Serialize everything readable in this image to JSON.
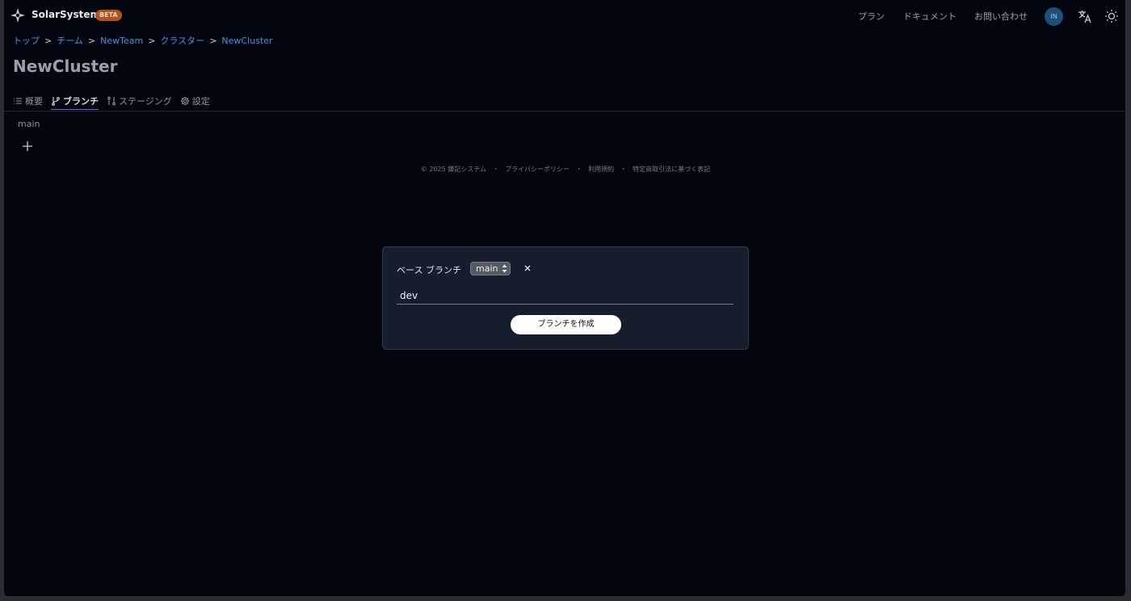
{
  "header": {
    "brand": "SolarSystem",
    "badge": "BETA",
    "nav": [
      "プラン",
      "ドキュメント",
      "お問い合わせ"
    ],
    "avatar_initials": "IN"
  },
  "breadcrumb": [
    "トップ",
    "チーム",
    "NewTeam",
    "クラスター",
    "NewCluster"
  ],
  "breadcrumb_separator": ">",
  "page_title": "NewCluster",
  "tabs": [
    {
      "label": "概要",
      "icon": "list-icon"
    },
    {
      "label": "ブランチ",
      "icon": "git-branch-icon",
      "active": true
    },
    {
      "label": "ステージング",
      "icon": "git-compare-icon"
    },
    {
      "label": "設定",
      "icon": "gear-icon"
    }
  ],
  "branches": [
    "main"
  ],
  "footer": {
    "copyright": "© 2025 鎌記システム",
    "privacy": "プライバシーポリシー",
    "terms": "利用規約",
    "commerce": "特定商取引法に基づく表記",
    "separator": "・"
  },
  "modal": {
    "base_branch_label": "ベース ブランチ",
    "base_branch_value": "main",
    "new_branch_value": "dev",
    "create_button": "ブランチを作成"
  },
  "colors": {
    "background": "#03060e",
    "link": "#4d8fe0",
    "badge": "#b0521e",
    "modal_bg": "#161d2c",
    "tab_underline": "#7a61e0"
  }
}
